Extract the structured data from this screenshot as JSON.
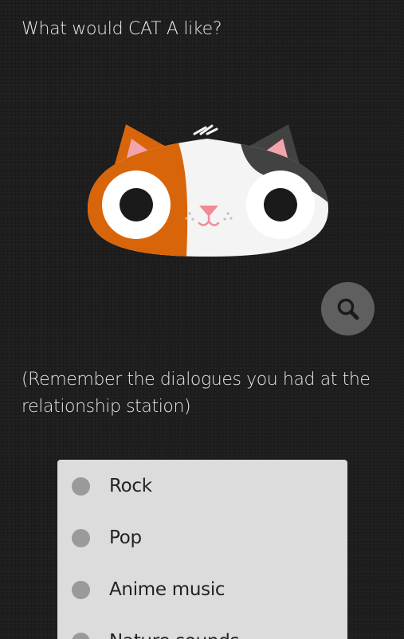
{
  "question": {
    "text": "What would CAT A like?"
  },
  "cat": {
    "icon": "cat-face-icon",
    "colors": {
      "orange": "#d9650a",
      "white": "#f4f4f4",
      "dark": "#424242",
      "pink_ear": "#f2a4ad",
      "nose": "#f08a95"
    }
  },
  "search_button": {
    "icon": "magnifier-icon",
    "color": "#5f5f5f"
  },
  "hint": {
    "line1": "(Remember the dialogues you had at the",
    "line2": "relationship station)"
  },
  "options": {
    "items": [
      {
        "label": "Rock"
      },
      {
        "label": "Pop"
      },
      {
        "label": "Anime music"
      },
      {
        "label": "Nature sounds"
      }
    ]
  }
}
